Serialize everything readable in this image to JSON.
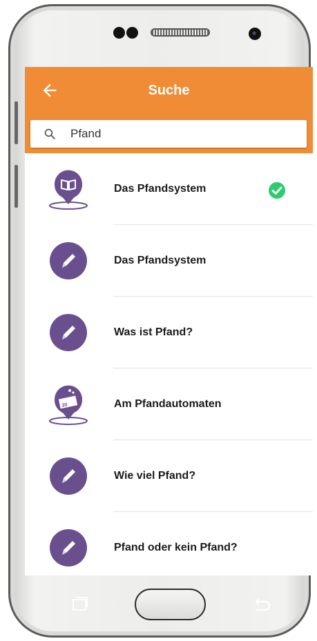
{
  "appbar": {
    "title": "Suche"
  },
  "search": {
    "value": "Pfand",
    "placeholder": ""
  },
  "results": [
    {
      "label": "Das Pfandsystem",
      "icon": "book-pin-icon",
      "completed": true
    },
    {
      "label": "Das Pfandsystem",
      "icon": "pencil-icon",
      "completed": false
    },
    {
      "label": "Was ist Pfand?",
      "icon": "pencil-icon",
      "completed": false
    },
    {
      "label": "Am Pfandautomaten",
      "icon": "bottle-machine-pin-icon",
      "completed": false
    },
    {
      "label": "Wie viel Pfand?",
      "icon": "pencil-icon",
      "completed": false
    },
    {
      "label": "Pfand oder kein Pfand?",
      "icon": "pencil-icon",
      "completed": false
    }
  ],
  "machine_icon_text": "20",
  "colors": {
    "accent": "#f08c35",
    "icon_purple": "#6a4f8f",
    "check_green": "#2ecc71"
  }
}
